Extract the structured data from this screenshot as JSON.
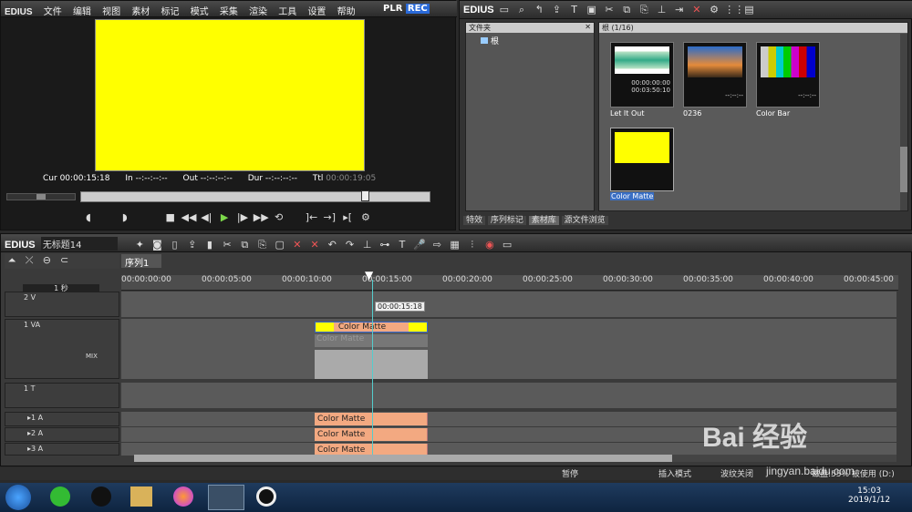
{
  "player": {
    "logo": "EDIUS",
    "menu": [
      "文件",
      "编辑",
      "视图",
      "素材",
      "标记",
      "模式",
      "采集",
      "渲染",
      "工具",
      "设置",
      "帮助"
    ],
    "plr": "PLR",
    "rec": "REC",
    "tc": {
      "cur_label": "Cur",
      "cur": "00:00:15:18",
      "in_label": "In",
      "in": "--:--:--:--",
      "out_label": "Out",
      "out": "--:--:--:--",
      "dur_label": "Dur",
      "dur": "--:--:--:--",
      "ttl_label": "Ttl",
      "ttl": "00:00:19:05"
    },
    "preview_color": "#ffff00"
  },
  "bin": {
    "logo": "EDIUS",
    "folder_title": "文件夹",
    "root": "根",
    "clip_header": "根 (1/16)",
    "clips": [
      {
        "name": "Let It Out",
        "tc1": "00:00:00:00",
        "tc2": "00:03:50:10"
      },
      {
        "name": "0236",
        "tc1": "--:--:--",
        "tc2": ""
      },
      {
        "name": "Color Bar",
        "tc1": "--:--:--",
        "tc2": ""
      },
      {
        "name": "Color Matte",
        "tc1": "",
        "tc2": ""
      }
    ],
    "tabs": [
      "特效",
      "序列标记",
      "素材库",
      "源文件浏览"
    ]
  },
  "timeline": {
    "logo": "EDIUS",
    "project": "无标题14",
    "sequence_tab": "序列1",
    "scale": "1 秒",
    "ruler": [
      "00:00:00:00",
      "00:00:05:00",
      "00:00:10:00",
      "00:00:15:00",
      "00:00:20:00",
      "00:00:25:00",
      "00:00:30:00",
      "00:00:35:00",
      "00:00:40:00",
      "00:00:45:00"
    ],
    "cursor_tc": "00:00:15:18",
    "tracks": {
      "v2": "2 V",
      "va1": "1 VA",
      "t1": "1 T",
      "a1": "▸1 A",
      "a2": "▸2 A",
      "a3": "▸3 A",
      "mix": "MIX"
    },
    "clip_label": "Color Matte"
  },
  "status": {
    "s1": "暂停",
    "s2": "插入模式",
    "s3": "波纹关闭",
    "s4": "磁盘:55% 被使用 (D:)"
  },
  "taskbar": {
    "time": "15:03",
    "date": "2019/1/12"
  },
  "watermark": {
    "brand": "Bai  经验",
    "url": "jingyan.baidu.com"
  }
}
